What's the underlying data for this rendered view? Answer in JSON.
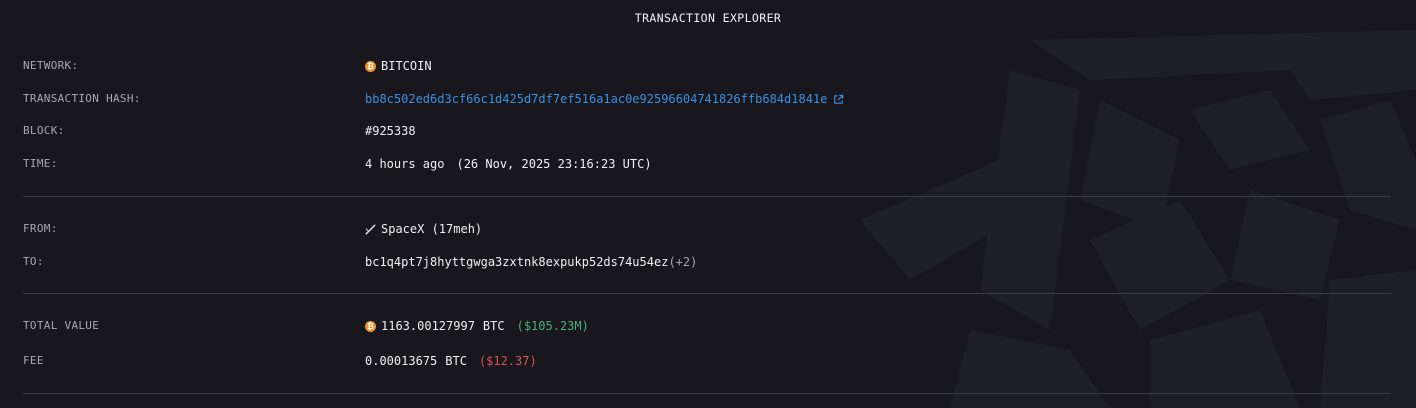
{
  "header": {
    "title": "TRANSACTION EXPLORER"
  },
  "details": {
    "network_label": "NETWORK:",
    "network_value": "BITCOIN",
    "hash_label": "TRANSACTION HASH:",
    "hash_value": "bb8c502ed6d3cf66c1d425d7df7ef516a1ac0e92596604741826ffb684d1841e",
    "block_label": "BLOCK:",
    "block_value": "#925338",
    "time_label": "TIME:",
    "time_relative": "4 hours ago",
    "time_absolute": "(26 Nov, 2025 23:16:23 UTC)"
  },
  "parties": {
    "from_label": "FROM:",
    "from_value": "SpaceX (17meh)",
    "to_label": "TO:",
    "to_value": "bc1q4pt7j8hyttgwga3zxtnk8expukp52ds74u54ez",
    "to_extra": "(+2)"
  },
  "amounts": {
    "total_label": "TOTAL VALUE",
    "total_value": "1163.00127997",
    "total_unit": "BTC",
    "total_usd": "($105.23M)",
    "fee_label": "FEE",
    "fee_value": "0.00013675",
    "fee_unit": "BTC",
    "fee_usd": "($12.37)"
  },
  "icons": {
    "network": "bitcoin-icon",
    "hash_link": "external-link-icon",
    "from": "x-logo-icon",
    "total": "bitcoin-icon"
  },
  "colors": {
    "background": "#17171d",
    "link": "#3d8fe0",
    "positive": "#4caf7a",
    "negative": "#e0524f",
    "bitcoin": "#f0932b"
  }
}
